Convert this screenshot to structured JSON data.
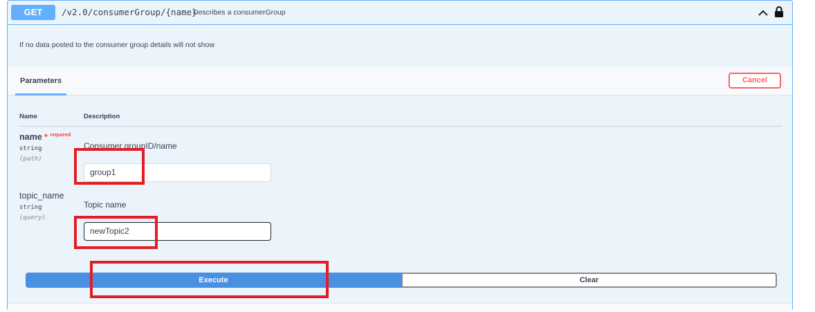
{
  "operation": {
    "method": "GET",
    "path": "/v2.0/consumerGroup/{name}",
    "summary": "Describes a consumerGroup",
    "description": "If no data posted to the consumer group details will not show"
  },
  "parameters_section": {
    "tab_label": "Parameters",
    "cancel_label": "Cancel",
    "col_name": "Name",
    "col_description": "Description",
    "params": [
      {
        "name": "name",
        "required_star": "*",
        "required_label": "required",
        "type": "string",
        "in": "(path)",
        "description": "Consumer groupID/name",
        "value": "group1"
      },
      {
        "name": "topic_name",
        "type": "string",
        "in": "(query)",
        "description": "Topic name",
        "value": "newTopic2"
      }
    ]
  },
  "actions": {
    "execute_label": "Execute",
    "clear_label": "Clear"
  },
  "colors": {
    "get_accent": "#61affe",
    "execute_blue": "#4990e2",
    "cancel_red": "#ff6060",
    "highlight_red": "#e51c23"
  }
}
